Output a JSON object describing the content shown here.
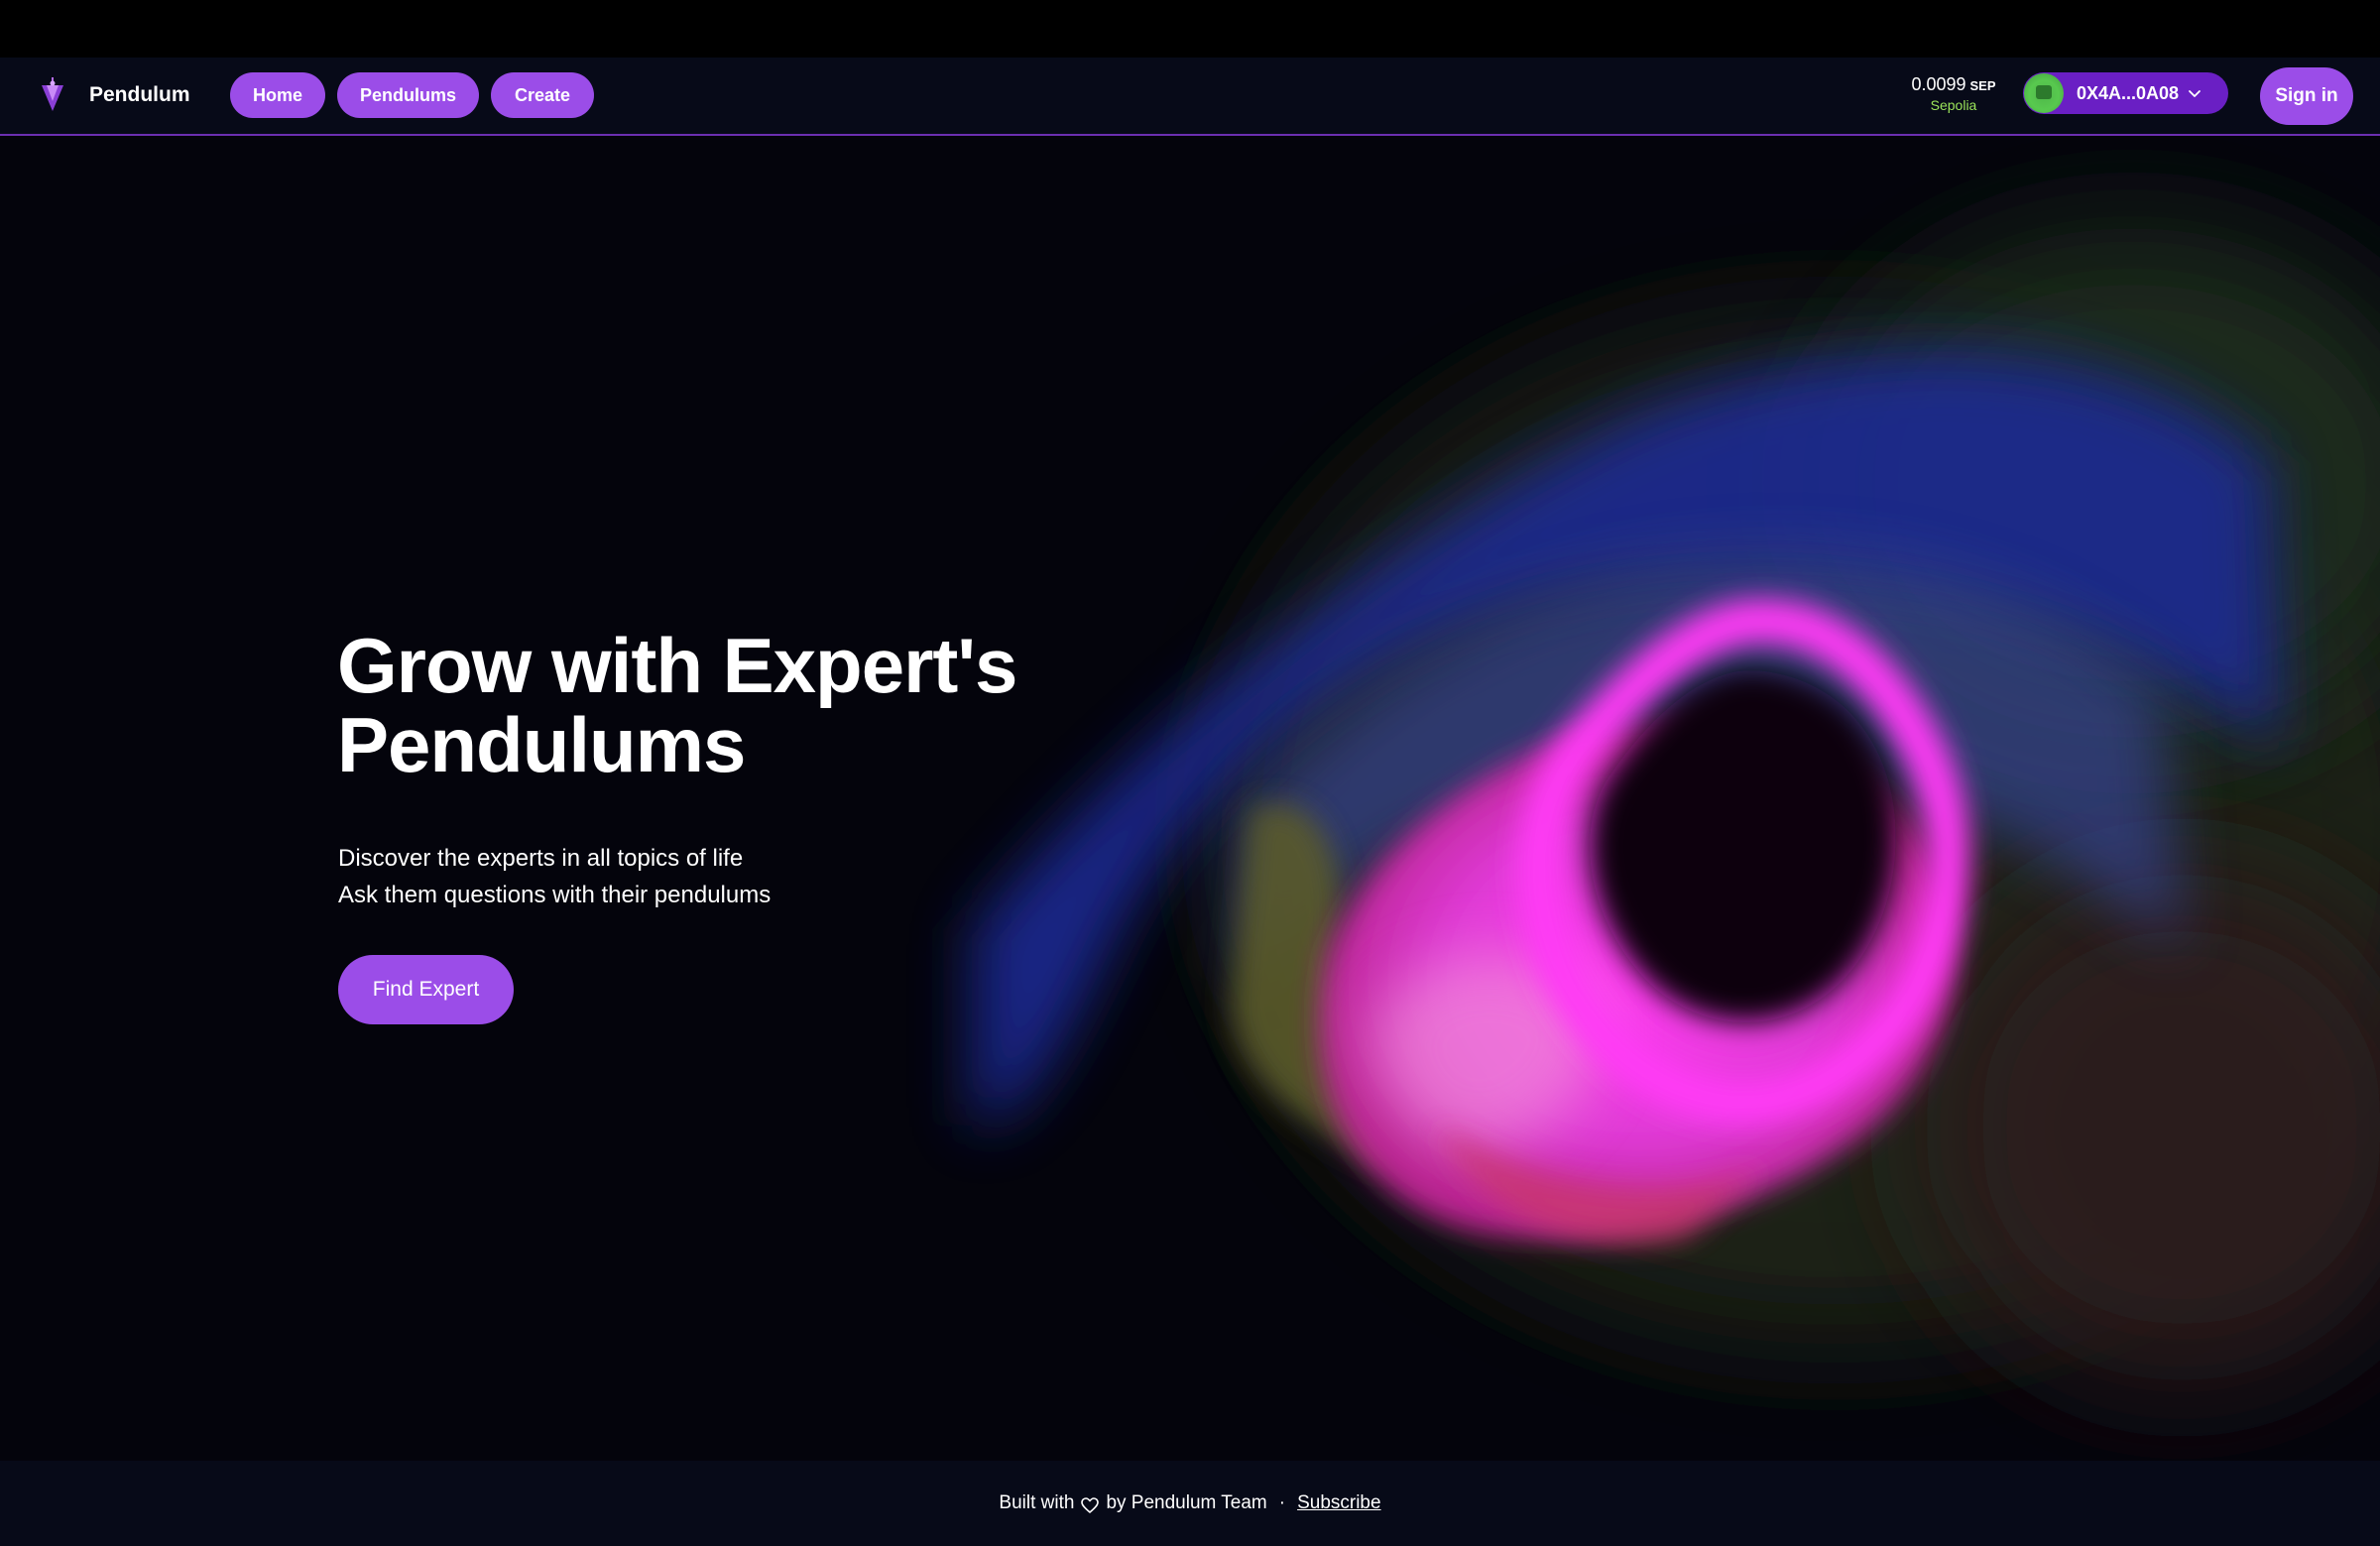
{
  "brand": {
    "name": "Pendulum",
    "icon": "pendulum-logo-icon",
    "accent": "#9b4de8"
  },
  "nav": {
    "items": [
      {
        "label": "Home"
      },
      {
        "label": "Pendulums"
      },
      {
        "label": "Create"
      }
    ]
  },
  "wallet": {
    "balance": "0.0099",
    "currency": "SEP",
    "network": "Sepolia",
    "address": "0X4A...0A08",
    "avatar_icon": "avatar-icon",
    "chevron_icon": "chevron-down-icon"
  },
  "auth": {
    "signin_label": "Sign in"
  },
  "hero": {
    "title_line1": "Grow with Expert's",
    "title_line2": "Pendulums",
    "subtitle_line1": "Discover the experts in all topics of life",
    "subtitle_line2": "Ask them questions with their pendulums",
    "cta_label": "Find Expert"
  },
  "footer": {
    "built_with": "Built with",
    "heart_icon": "heart-icon",
    "by_text": "by Pendulum Team",
    "separator": "·",
    "subscribe_label": "Subscribe"
  },
  "colors": {
    "background": "#04040c",
    "navbar": "#070a18",
    "nav_border": "#6b2fb0",
    "network_green": "#9be45a",
    "wallet_bg": "#6a1fc4"
  }
}
